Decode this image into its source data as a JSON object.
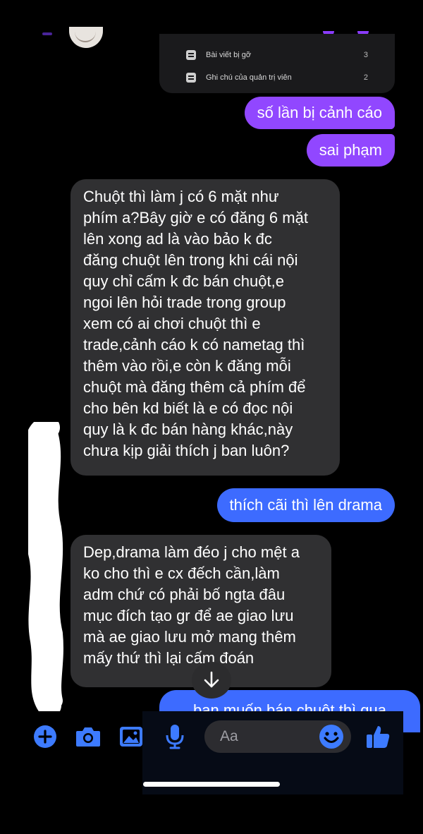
{
  "admin_card": {
    "rows": [
      {
        "label": "Bài viết bị gỡ",
        "count": "3",
        "icon": "document-icon"
      },
      {
        "label": "Ghi chú của quản trị viên",
        "count": "2",
        "icon": "notes-icon"
      }
    ]
  },
  "messages": [
    {
      "from": "me",
      "text": "số lần bị cảnh cáo"
    },
    {
      "from": "me",
      "text": "sai phạm"
    },
    {
      "from": "them",
      "text": "Chuột thì làm j có 6 mặt như\nphím a?Bây giờ e có đăng 6 mặt\nlên xong ad là vào bảo k đc\nđăng chuột lên trong khi cái nội\nquy chỉ cấm k đc bán chuột,e\nngoi lên hỏi trade trong group\nxem có ai chơi chuột thì e\ntrade,cảnh cáo k có nametag thì\nthêm vào rồi,e còn k đăng mỗi\nchuột mà đăng thêm cả phím để\ncho bên kd biết là e có đọc nội\nquy là k đc bán hàng khác,này\nchưa kịp giải thích j ban luôn?"
    },
    {
      "from": "me",
      "text": "thích cãi thì lên drama"
    },
    {
      "from": "them",
      "text": "Dep,drama làm đéo j cho mệt a\nko cho thì e cx đếch cần,làm\nadm chứ có phải bố ngta đâu\nmục đích tạo gr để ae giao lưu\nmà ae giao lưu mở mang thêm\nmấy thứ thì lại cấm đoán"
    },
    {
      "from": "me",
      "text": "bạn muốn bán chuột thì qua"
    }
  ],
  "composer": {
    "placeholder": "Aa",
    "icons": [
      "plus-icon",
      "camera-icon",
      "gallery-icon",
      "microphone-icon",
      "emoji-icon",
      "thumbs-up-icon"
    ]
  },
  "colors": {
    "sent_purple": "#9147ff",
    "sent_blue": "#3d6bff",
    "received": "#303032",
    "accent_icon": "#3d7bff"
  }
}
